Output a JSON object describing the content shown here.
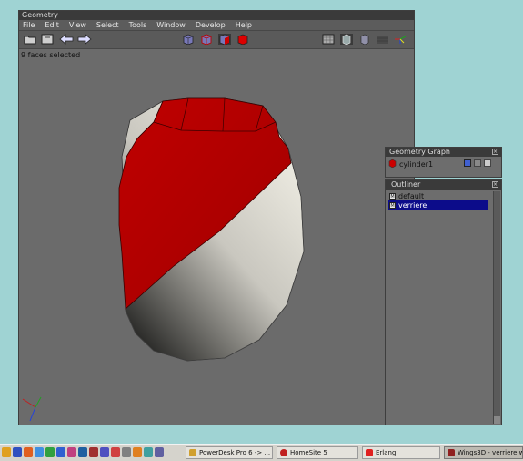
{
  "geometry_window": {
    "title": "Geometry",
    "menu": [
      "File",
      "Edit",
      "View",
      "Select",
      "Tools",
      "Window",
      "Develop",
      "Help"
    ],
    "status": "9 faces selected",
    "toolbar_left_icons": [
      "open-folder-icon",
      "save-icon",
      "undo-arrow-icon",
      "redo-arrow-icon"
    ],
    "toolbar_mode_icons": [
      "vertex-mode-icon",
      "edge-mode-icon",
      "face-mode-icon",
      "body-mode-icon"
    ],
    "toolbar_right_icons": [
      "groundplane-icon",
      "wireframe-icon",
      "smooth-icon",
      "shaded-icon",
      "axes-icon"
    ]
  },
  "geometry_graph": {
    "title": "Geometry Graph",
    "items": [
      {
        "label": "cylinder1"
      }
    ]
  },
  "outliner": {
    "title": "Outliner",
    "items": [
      {
        "label": "default",
        "icon": "M",
        "selected": false
      },
      {
        "label": "verriere",
        "icon": "M",
        "selected": true
      }
    ]
  },
  "taskbar": {
    "tasks": [
      {
        "label": "PowerDesk Pro 6 -> ...",
        "active": false
      },
      {
        "label": "HomeSite 5",
        "active": false
      },
      {
        "label": "Erlang",
        "active": false
      },
      {
        "label": "Wings3D - verriere.wi...",
        "active": true
      }
    ]
  },
  "colors": {
    "desktop": "#9fd3d3",
    "selected_faces": "#b30000",
    "unselected_faces": "#d8d8d2",
    "selection_highlight": "#0c0c8a"
  }
}
